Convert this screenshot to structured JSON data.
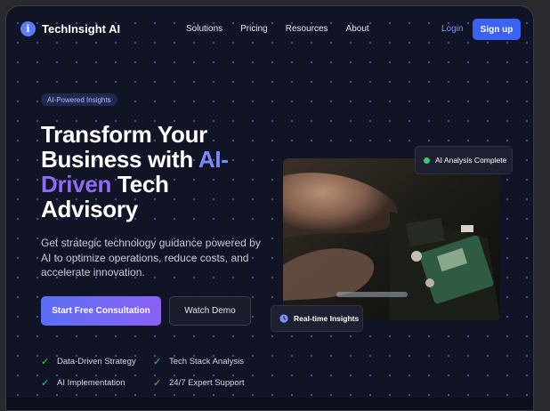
{
  "brand": {
    "name": "TechInsight AI",
    "logo_glyph": "i",
    "accent": "#5b7cf6"
  },
  "nav": {
    "links": [
      "Solutions",
      "Pricing",
      "Resources",
      "About"
    ],
    "login_label": "Login",
    "signup_label": "Sign up"
  },
  "hero": {
    "badge": "AI-Powered Insights",
    "headline": {
      "part1": "Transform Your Business with ",
      "accent1": "AI-",
      "accent2": "Driven",
      "part2": " Tech Advisory"
    },
    "subtitle": "Get strategic technology guidance powered by AI to optimize operations, reduce costs, and accelerate innovation.",
    "primary_cta": "Start Free Consultation",
    "secondary_cta": "Watch Demo",
    "features": [
      "Data-Driven Strategy",
      "Tech Stack Analysis",
      "AI Implementation",
      "24/7 Expert Support"
    ]
  },
  "cards": {
    "status": "AI Analysis Complete",
    "status_color": "#3fc86e",
    "realtime": "Real-time Insights"
  },
  "icons": {
    "check": "check-icon",
    "clock": "clock-icon",
    "status_dot": "status-dot-icon"
  }
}
